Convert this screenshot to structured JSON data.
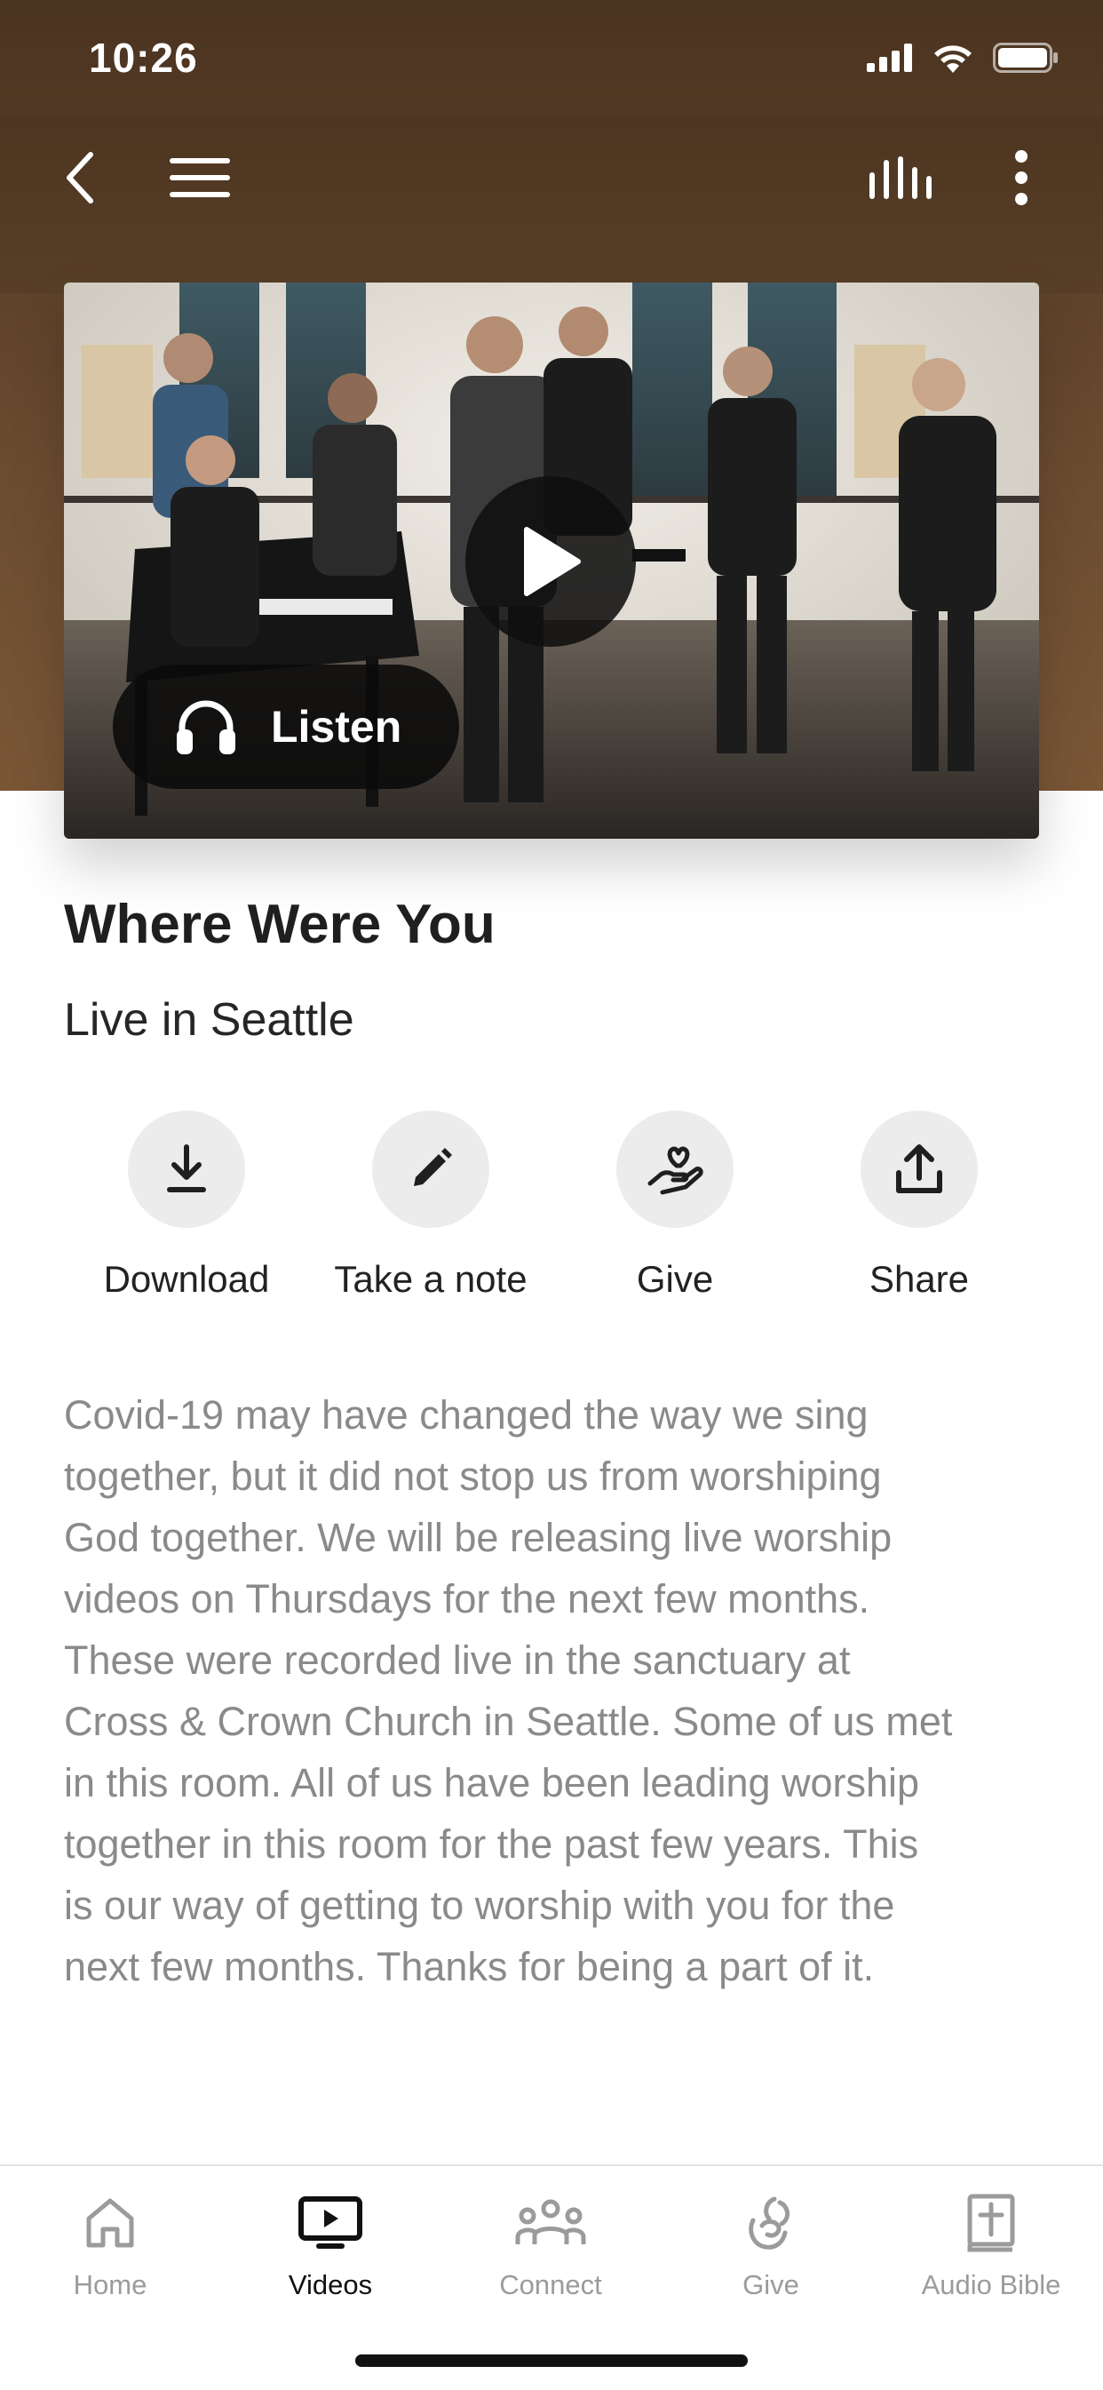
{
  "status_bar": {
    "time": "10:26"
  },
  "header": {
    "back_icon": "chevron-left-icon",
    "menu_icon": "hamburger-icon",
    "audio_icon": "audio-bars-icon",
    "more_icon": "more-vertical-icon"
  },
  "media": {
    "listen_label": "Listen",
    "play_icon": "play-icon"
  },
  "content": {
    "title": "Where Were You",
    "subtitle": "Live in Seattle",
    "actions": [
      {
        "label": "Download",
        "icon": "download-icon"
      },
      {
        "label": "Take a note",
        "icon": "pencil-icon"
      },
      {
        "label": "Give",
        "icon": "hand-heart-icon"
      },
      {
        "label": "Share",
        "icon": "share-icon"
      }
    ],
    "description": "Covid-19 may have changed the way we sing\ntogether, but it did not stop us from worshiping\nGod together. We will be releasing live worship\nvideos on Thursdays for the next few months.\nThese were recorded live in the sanctuary at\nCross & Crown Church in Seattle. Some of us met\nin this room. All of us have been leading worship\ntogether in this room for the past few years. This\nis our way of getting to worship with you for the\nnext few months. Thanks for being a part of it."
  },
  "tabs": [
    {
      "label": "Home",
      "icon": "home-icon",
      "active": false
    },
    {
      "label": "Videos",
      "icon": "tv-play-icon",
      "active": true
    },
    {
      "label": "Connect",
      "icon": "people-icon",
      "active": false
    },
    {
      "label": "Give",
      "icon": "give-icon",
      "active": false
    },
    {
      "label": "Audio Bible",
      "icon": "bible-icon",
      "active": false
    }
  ],
  "colors": {
    "header_brown": "#5a3e27",
    "description_gray": "#8a8a8a",
    "tab_inactive": "#9b9b9b"
  }
}
